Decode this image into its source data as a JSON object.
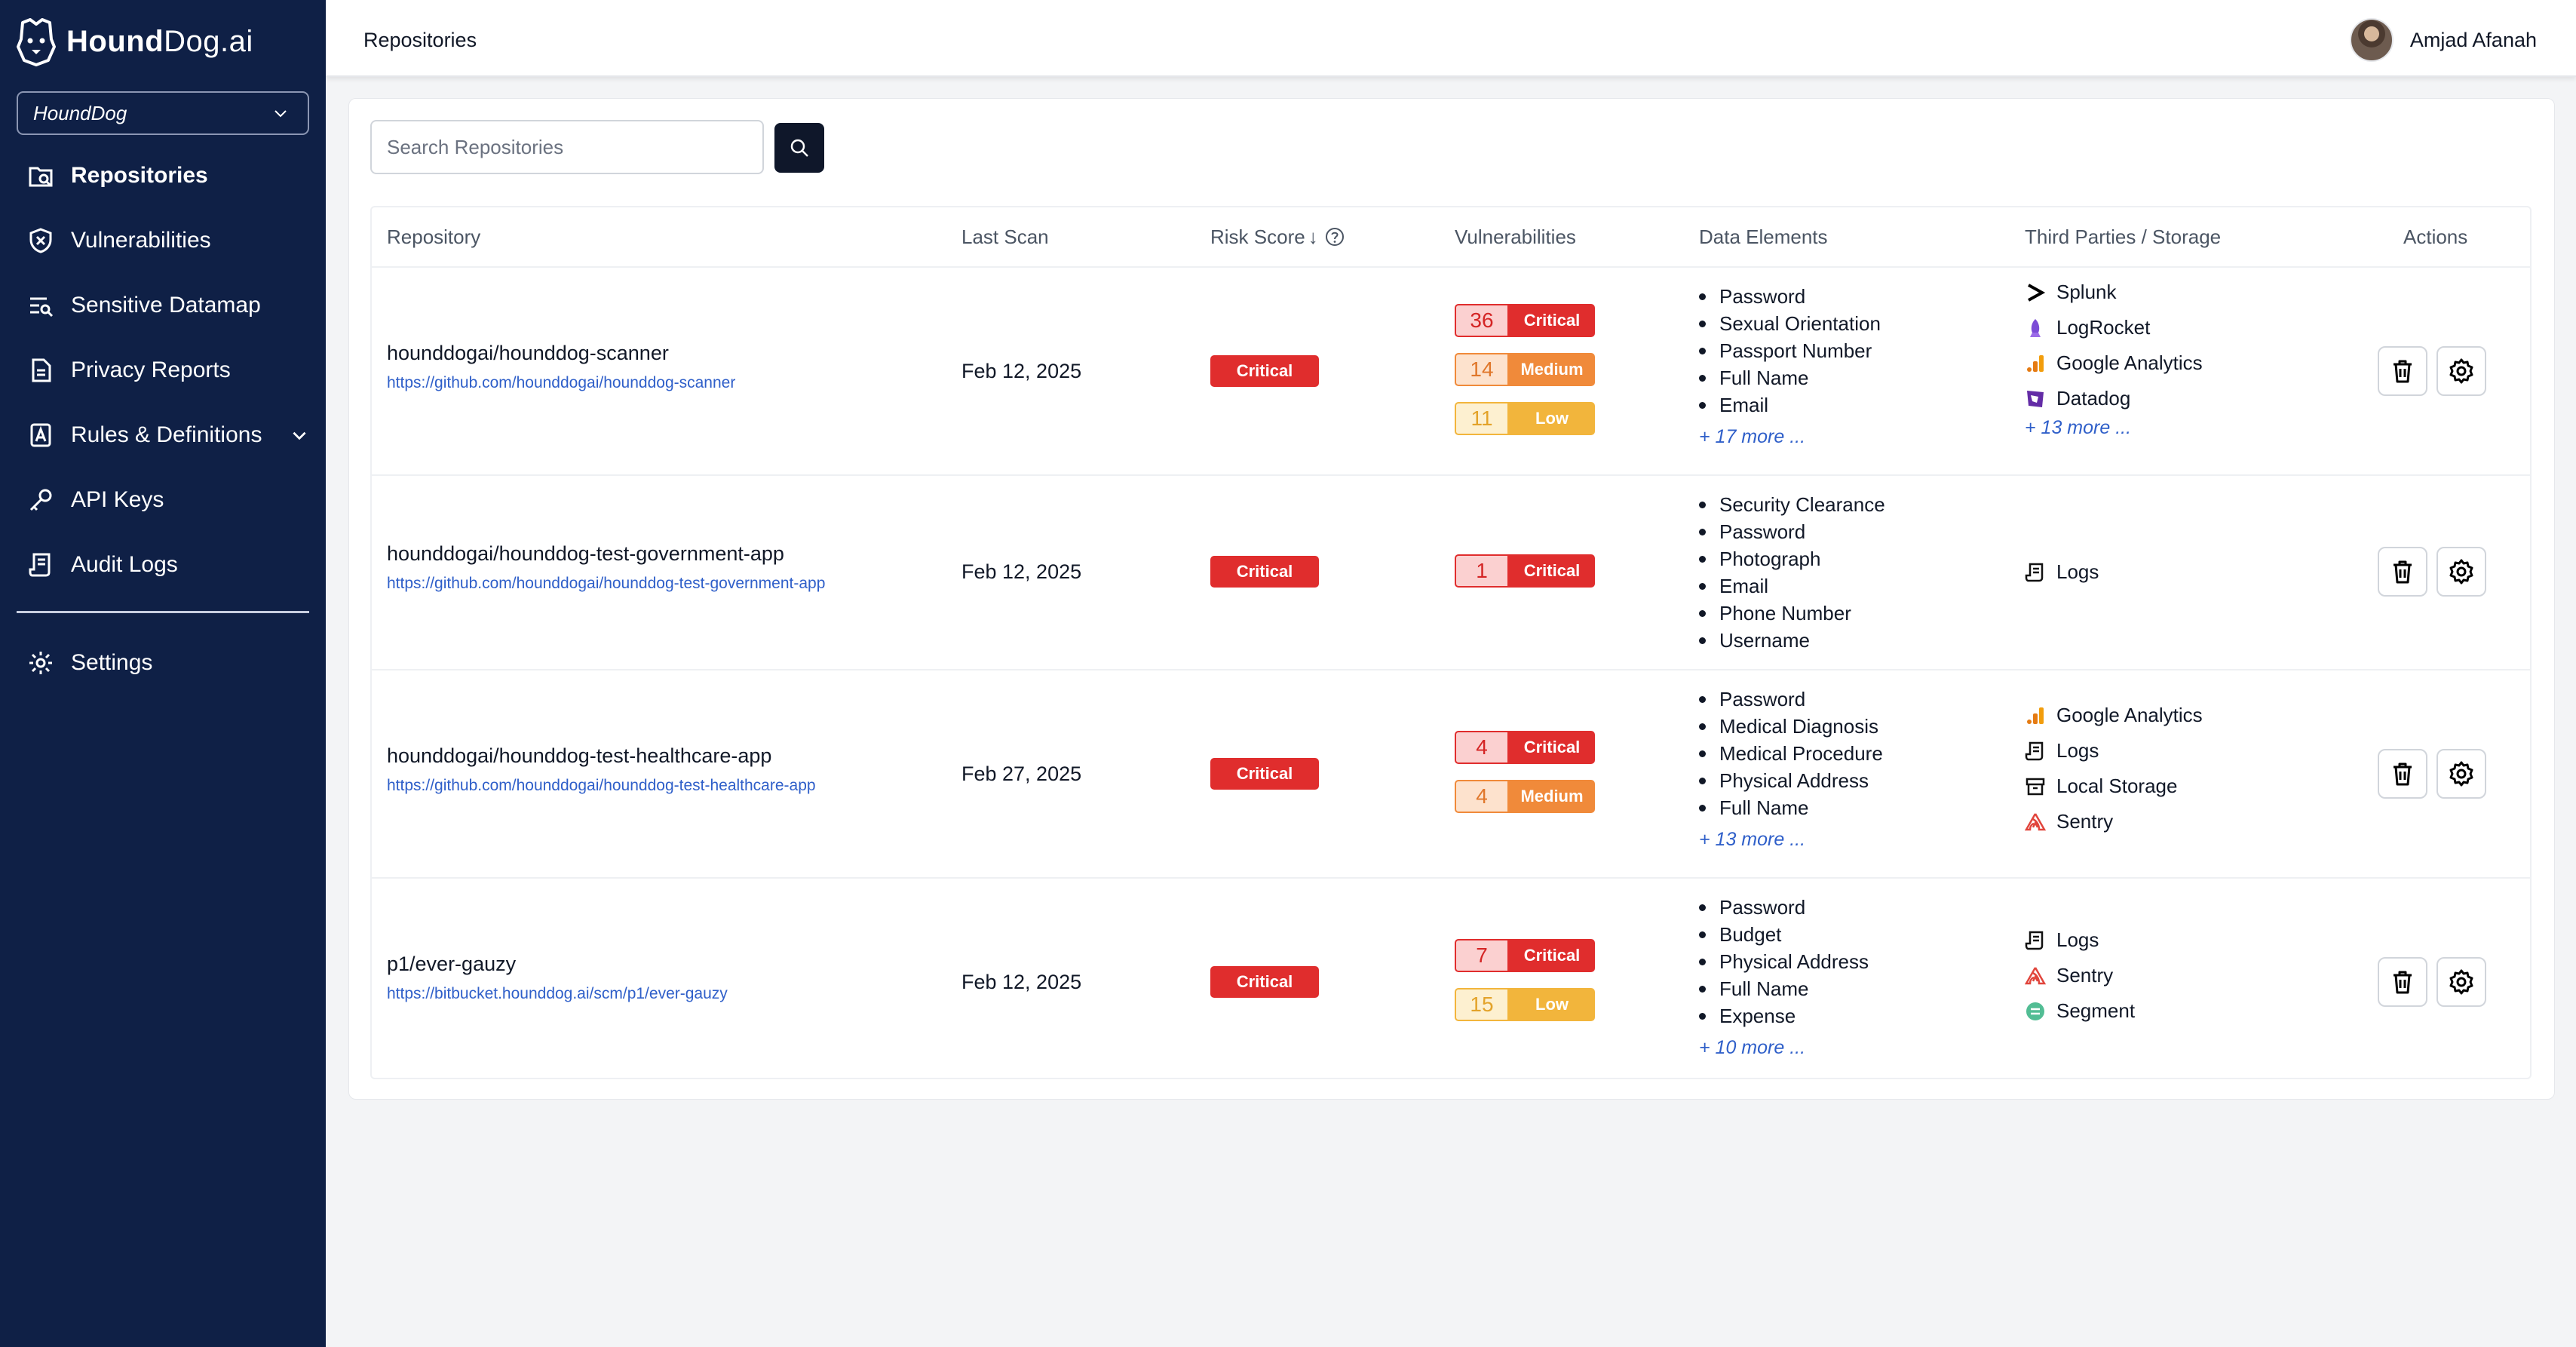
{
  "app": {
    "logo_bold": "Hound",
    "logo_rest": "Dog.ai",
    "org_selected": "HoundDog"
  },
  "sidebar": {
    "items": [
      {
        "label": "Repositories",
        "icon": "repository-icon",
        "active": true
      },
      {
        "label": "Vulnerabilities",
        "icon": "shield-x-icon"
      },
      {
        "label": "Sensitive Datamap",
        "icon": "datamap-icon"
      },
      {
        "label": "Privacy Reports",
        "icon": "report-icon"
      },
      {
        "label": "Rules & Definitions",
        "icon": "rules-icon",
        "expandable": true
      },
      {
        "label": "API Keys",
        "icon": "key-icon"
      },
      {
        "label": "Audit Logs",
        "icon": "logs-icon"
      },
      {
        "label": "Settings",
        "icon": "gear-icon"
      }
    ]
  },
  "header": {
    "breadcrumb": "Repositories",
    "user_name": "Amjad Afanah"
  },
  "search": {
    "placeholder": "Search Repositories",
    "value": ""
  },
  "table": {
    "columns": {
      "repository": "Repository",
      "last_scan": "Last Scan",
      "risk_score": "Risk Score",
      "vulnerabilities": "Vulnerabilities",
      "data_elements": "Data Elements",
      "third_parties": "Third Parties / Storage",
      "actions": "Actions"
    },
    "rows": [
      {
        "name": "hounddogai/hounddog-scanner",
        "url": "https://github.com/hounddogai/hounddog-scanner",
        "last_scan": "Feb 12, 2025",
        "risk": "Critical",
        "vulns": [
          {
            "count": "36",
            "level": "Critical"
          },
          {
            "count": "14",
            "level": "Medium"
          },
          {
            "count": "11",
            "level": "Low"
          }
        ],
        "data_elements": [
          "Password",
          "Sexual Orientation",
          "Passport Number",
          "Full Name",
          "Email"
        ],
        "data_more": "+ 17 more ...",
        "third_parties": [
          {
            "name": "Splunk",
            "icon": "splunk-icon"
          },
          {
            "name": "LogRocket",
            "icon": "logrocket-icon"
          },
          {
            "name": "Google Analytics",
            "icon": "google-analytics-icon"
          },
          {
            "name": "Datadog",
            "icon": "datadog-icon"
          }
        ],
        "tp_more": "+ 13 more ..."
      },
      {
        "name": "hounddogai/hounddog-test-government-app",
        "url": "https://github.com/hounddogai/hounddog-test-government-app",
        "last_scan": "Feb 12, 2025",
        "risk": "Critical",
        "vulns": [
          {
            "count": "1",
            "level": "Critical"
          }
        ],
        "data_elements": [
          "Security Clearance",
          "Password",
          "Photograph",
          "Email",
          "Phone Number",
          "Username"
        ],
        "data_more": "",
        "third_parties": [
          {
            "name": "Logs",
            "icon": "logs-icon"
          }
        ],
        "tp_more": ""
      },
      {
        "name": "hounddogai/hounddog-test-healthcare-app",
        "url": "https://github.com/hounddogai/hounddog-test-healthcare-app",
        "last_scan": "Feb 27, 2025",
        "risk": "Critical",
        "vulns": [
          {
            "count": "4",
            "level": "Critical"
          },
          {
            "count": "4",
            "level": "Medium"
          }
        ],
        "data_elements": [
          "Password",
          "Medical Diagnosis",
          "Medical Procedure",
          "Physical Address",
          "Full Name"
        ],
        "data_more": "+ 13 more ...",
        "third_parties": [
          {
            "name": "Google Analytics",
            "icon": "google-analytics-icon"
          },
          {
            "name": "Logs",
            "icon": "logs-icon"
          },
          {
            "name": "Local Storage",
            "icon": "storage-icon"
          },
          {
            "name": "Sentry",
            "icon": "sentry-icon"
          }
        ],
        "tp_more": ""
      },
      {
        "name": "p1/ever-gauzy",
        "url": "https://bitbucket.hounddog.ai/scm/p1/ever-gauzy",
        "last_scan": "Feb 12, 2025",
        "risk": "Critical",
        "vulns": [
          {
            "count": "7",
            "level": "Critical"
          },
          {
            "count": "15",
            "level": "Low"
          }
        ],
        "data_elements": [
          "Password",
          "Budget",
          "Physical Address",
          "Full Name",
          "Expense"
        ],
        "data_more": "+ 10 more ...",
        "third_parties": [
          {
            "name": "Logs",
            "icon": "logs-icon"
          },
          {
            "name": "Sentry",
            "icon": "sentry-icon"
          },
          {
            "name": "Segment",
            "icon": "segment-icon"
          }
        ],
        "tp_more": ""
      }
    ]
  }
}
